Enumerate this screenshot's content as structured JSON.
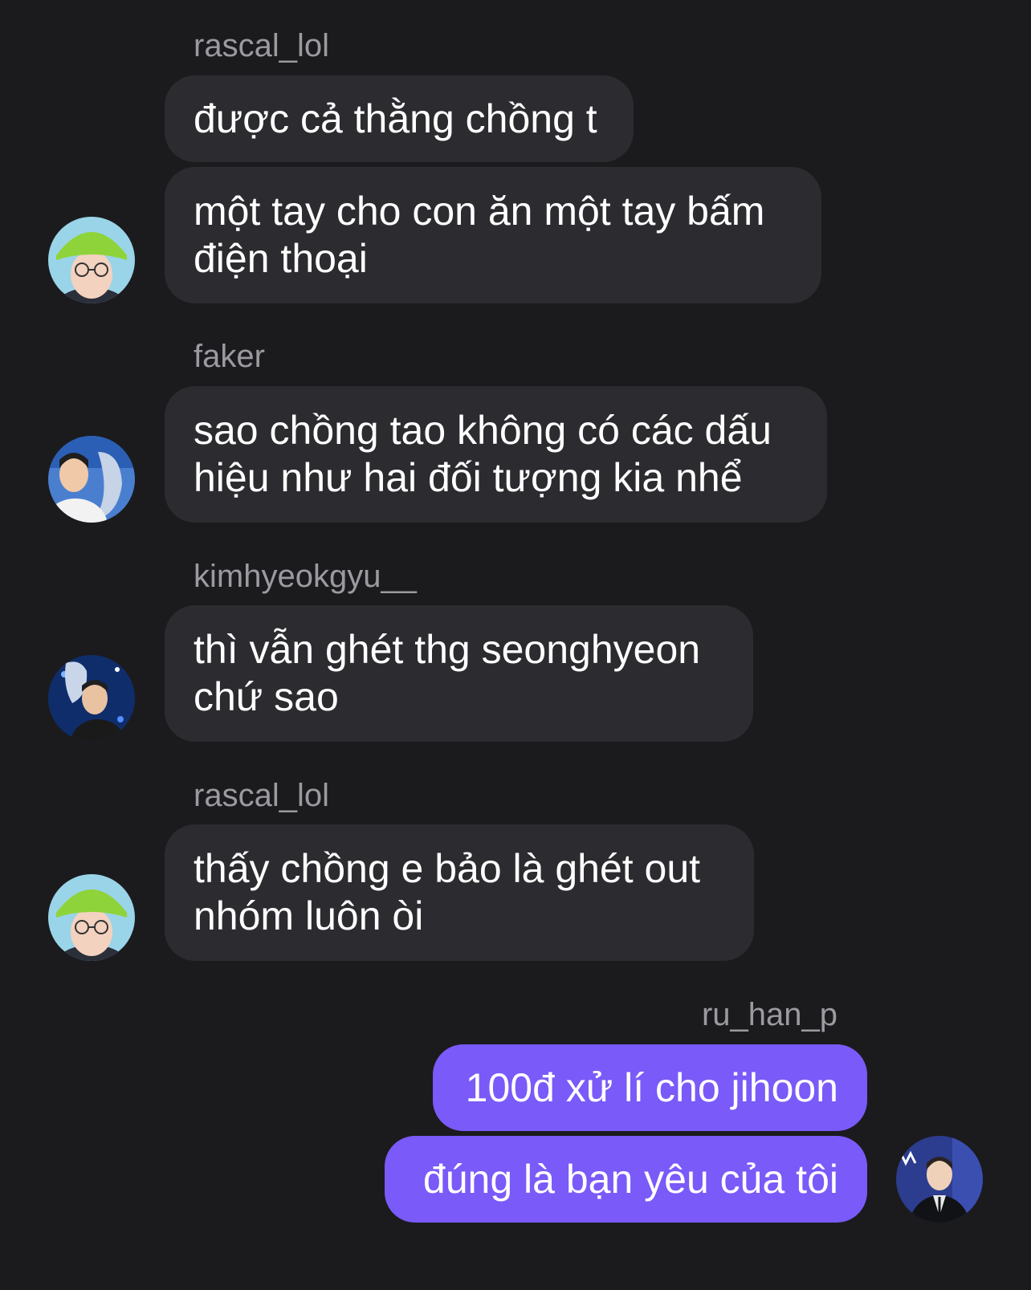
{
  "messages": {
    "group1": {
      "username": "rascal_lol",
      "bubble1": "được cả thằng chồng t",
      "bubble2": "một tay cho con ăn một tay bấm\nđiện thoại"
    },
    "group2": {
      "username": "faker",
      "bubble1": "sao chồng tao không có các dấu\nhiệu như hai đối tượng kia nhể"
    },
    "group3": {
      "username": "kimhyeokgyu__",
      "bubble1": "thì vẫn ghét thg seonghyeon\nchứ sao"
    },
    "group4": {
      "username": "rascal_lol",
      "bubble1": "thấy chồng e bảo là ghét out\nnhóm luôn òi"
    },
    "group5": {
      "username": "ru_han_p",
      "bubble1": "100đ xử lí cho jihoon",
      "bubble2": "đúng là bạn yêu của tôi"
    }
  },
  "colors": {
    "background": "#1b1b1e",
    "incoming_bubble": "#2c2c30",
    "outgoing_bubble": "#7a5af8",
    "username": "#9a9aa0"
  },
  "icons": {
    "avatars": [
      "avatar-rascal-lol",
      "avatar-faker",
      "avatar-kimhyeokgyu",
      "avatar-rascal-lol",
      "avatar-ru-han-p"
    ]
  }
}
